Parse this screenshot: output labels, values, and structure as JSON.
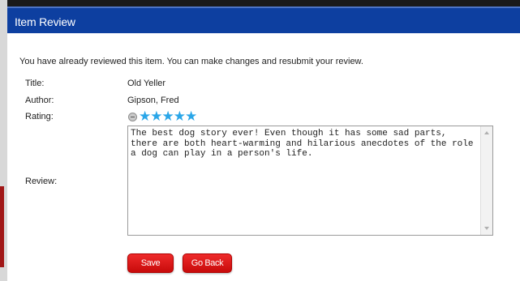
{
  "window": {
    "title": "Item Review"
  },
  "notice": "You have already reviewed this item. You can make changes and resubmit your review.",
  "fields": {
    "title_label": "Title:",
    "title_value": "Old Yeller",
    "author_label": "Author:",
    "author_value": "Gipson, Fred",
    "rating_label": "Rating:",
    "rating_value": 5,
    "rating_max": 5,
    "review_label": "Review:",
    "review_text": "The best dog story ever! Even though it has some sad parts, there are both heart-warming and hilarious anecdotes of the role a dog can play in a person's life."
  },
  "buttons": {
    "save_label": "Save",
    "back_label": "Go Back"
  },
  "icons": {
    "clear_rating": "clear-rating-icon",
    "star": "star-icon",
    "scroll_up": "scroll-up-arrow-icon",
    "scroll_down": "scroll-down-arrow-icon"
  },
  "colors": {
    "titlebar": "#0d3fa0",
    "star": "#2aa6e8",
    "button": "#d81414"
  }
}
